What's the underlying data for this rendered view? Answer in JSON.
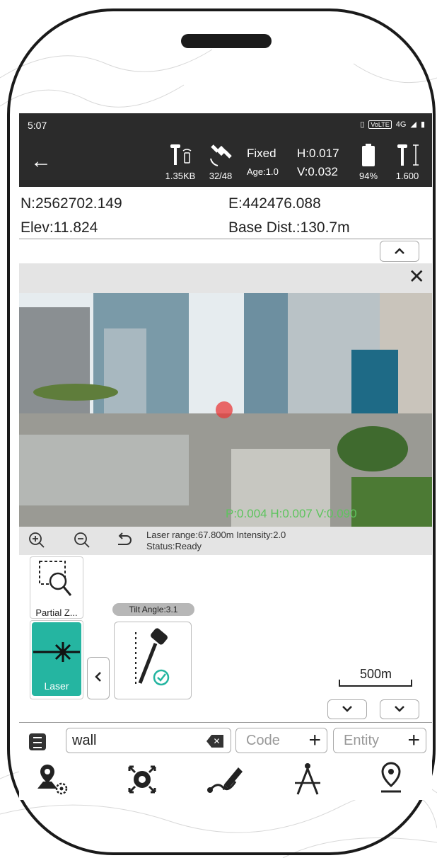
{
  "status": {
    "time": "5:07",
    "network": "4G",
    "volte": "VoLTE"
  },
  "toolbar": {
    "data_rate": "1.35KB",
    "satellites": "32/48",
    "solution": "Fixed",
    "age": "Age:1.0",
    "h_precision": "H:0.017",
    "v_precision": "V:0.032",
    "battery": "94%",
    "antenna_height": "1.600"
  },
  "coords": {
    "northing": "N:2562702.149",
    "easting": "E:442476.088",
    "elevation": "Elev:11.824",
    "base_dist": "Base Dist.:130.7m"
  },
  "camera": {
    "readout": "P:0.004 H:0.007 V:0.090",
    "laser_info": "Laser range:67.800m Intensity:2.0",
    "status": "Status:Ready"
  },
  "tools": {
    "partial_zoom": "Partial Z...",
    "laser": "Laser",
    "tilt_angle": "Tilt Angle:3.1"
  },
  "map": {
    "scale": "500m"
  },
  "input": {
    "point_name": "wall",
    "code_placeholder": "Code",
    "entity_placeholder": "Entity"
  },
  "colors": {
    "accent": "#25b5a1",
    "toolbar": "#2b2b2b",
    "readout": "#5ec45e"
  }
}
